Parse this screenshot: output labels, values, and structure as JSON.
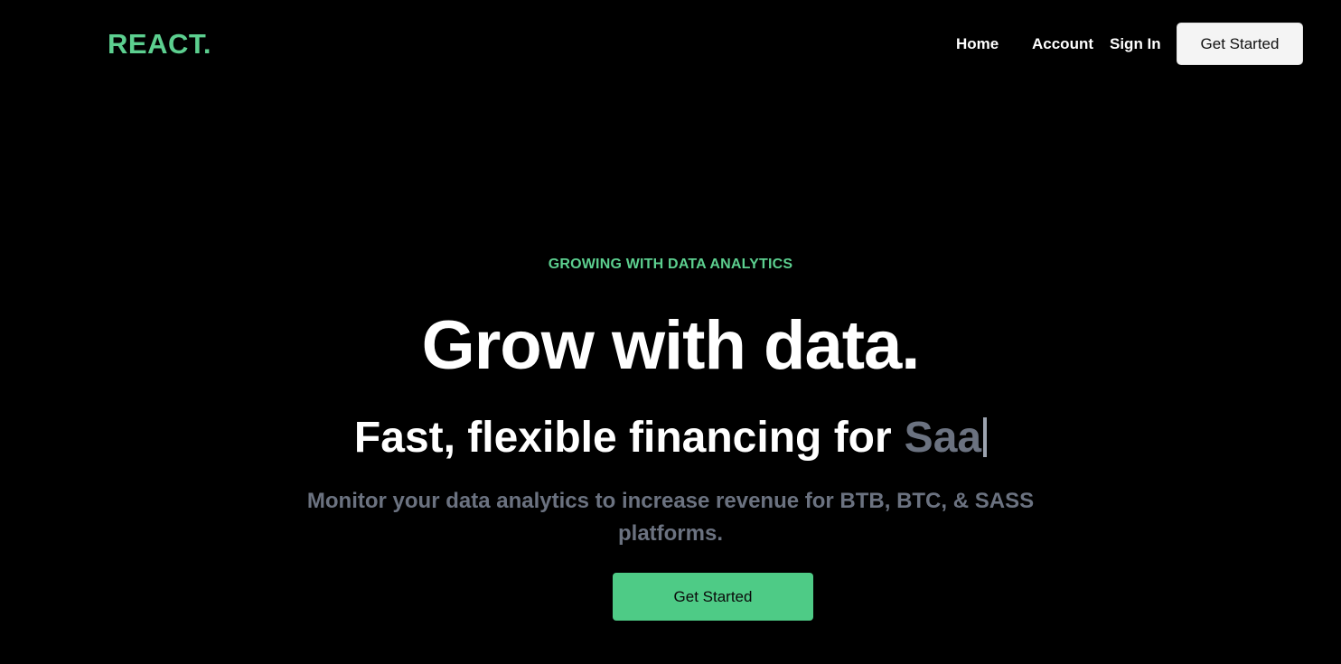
{
  "brand": {
    "logo": "REACT.",
    "accent_color": "#5ccf8f"
  },
  "nav": {
    "home": "Home",
    "account": "Account",
    "sign_in": "Sign In",
    "cta": "Get Started"
  },
  "hero": {
    "eyebrow": "GROWING WITH DATA ANALYTICS",
    "headline": "Grow with data.",
    "subline_static": "Fast, flexible financing for",
    "subline_typed": "Saa",
    "description_line1": "Monitor your data analytics to increase revenue for BTB, BTC, & SASS",
    "description_line2": "platforms.",
    "cta": "Get Started"
  }
}
